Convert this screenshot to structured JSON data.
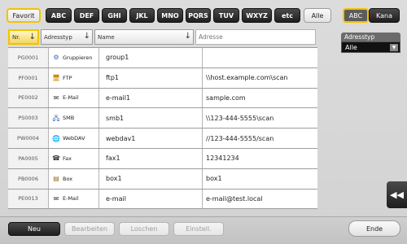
{
  "tabs": {
    "favorit": "Favorit",
    "letters": [
      "ABC",
      "DEF",
      "GHI",
      "JKL",
      "MNO",
      "PQRS",
      "TUV",
      "WXYZ",
      "etc"
    ],
    "alle": "Alle"
  },
  "mode": {
    "abc": "ABC",
    "kana": "Kana"
  },
  "headers": {
    "nr": "Nr.",
    "adresstyp": "Adresstyp",
    "name": "Name",
    "adresse": "Adresse"
  },
  "filter": {
    "label": "Adresstyp",
    "value": "Alle"
  },
  "rows": [
    {
      "nr": "PG0001",
      "type": "Gruppieren",
      "icon": "group-icon",
      "name": "group1",
      "address": ""
    },
    {
      "nr": "PF0001",
      "type": "FTP",
      "icon": "ftp-icon",
      "name": "ftp1",
      "address": "\\\\host.example.com\\scan"
    },
    {
      "nr": "PE0002",
      "type": "E-Mail",
      "icon": "email-icon",
      "name": "e-mail1",
      "address": "sample.com"
    },
    {
      "nr": "PS0003",
      "type": "SMB",
      "icon": "smb-icon",
      "name": "smb1",
      "address": "\\\\123-444-5555\\scan"
    },
    {
      "nr": "PW0004",
      "type": "WebDAV",
      "icon": "webdav-icon",
      "name": "webdav1",
      "address": "//123-444-5555/scan"
    },
    {
      "nr": "PA0005",
      "type": "Fax",
      "icon": "fax-icon",
      "name": "fax1",
      "address": "12341234"
    },
    {
      "nr": "PB0006",
      "type": "Box",
      "icon": "box-icon",
      "name": "box1",
      "address": "box1"
    },
    {
      "nr": "PE0013",
      "type": "E-Mail",
      "icon": "email-icon",
      "name": "e-mail",
      "address": "e-mail@test.local"
    }
  ],
  "bottom": {
    "neu": "Neu",
    "bearbeiten": "Bearbeiten",
    "loschen": "Loschen",
    "einstell": "Einstell.",
    "ende": "Ende"
  },
  "colors": {
    "selected_border": "#f2c300",
    "dark_button": "#2a2a2a"
  }
}
